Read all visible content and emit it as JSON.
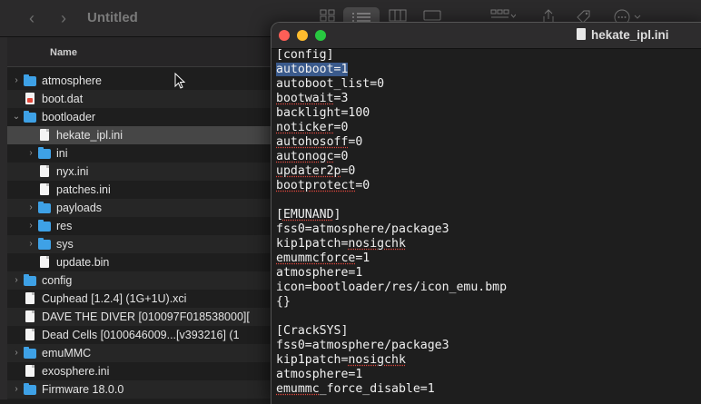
{
  "finder": {
    "title": "Untitled",
    "column_name": "Name",
    "rows": [
      {
        "label": "atmosphere",
        "type": "folder",
        "indent": 0,
        "disclosure": "›"
      },
      {
        "label": "boot.dat",
        "type": "dat",
        "indent": 0,
        "disclosure": ""
      },
      {
        "label": "bootloader",
        "type": "folder",
        "indent": 0,
        "disclosure": "⌄"
      },
      {
        "label": "hekate_ipl.ini",
        "type": "doc",
        "indent": 1,
        "disclosure": "",
        "selected": true
      },
      {
        "label": "ini",
        "type": "folder",
        "indent": 1,
        "disclosure": "›"
      },
      {
        "label": "nyx.ini",
        "type": "doc",
        "indent": 1,
        "disclosure": ""
      },
      {
        "label": "patches.ini",
        "type": "doc",
        "indent": 1,
        "disclosure": ""
      },
      {
        "label": "payloads",
        "type": "folder",
        "indent": 1,
        "disclosure": "›"
      },
      {
        "label": "res",
        "type": "folder",
        "indent": 1,
        "disclosure": "›"
      },
      {
        "label": "sys",
        "type": "folder",
        "indent": 1,
        "disclosure": "›"
      },
      {
        "label": "update.bin",
        "type": "doc",
        "indent": 1,
        "disclosure": ""
      },
      {
        "label": "config",
        "type": "folder",
        "indent": 0,
        "disclosure": "›"
      },
      {
        "label": "Cuphead [1.2.4] (1G+1U).xci",
        "type": "doc",
        "indent": 0,
        "disclosure": ""
      },
      {
        "label": "DAVE THE DIVER [010097F018538000][",
        "type": "doc",
        "indent": 0,
        "disclosure": ""
      },
      {
        "label": "Dead Cells [0100646009...[v393216] (1",
        "type": "doc",
        "indent": 0,
        "disclosure": ""
      },
      {
        "label": "emuMMC",
        "type": "folder",
        "indent": 0,
        "disclosure": "›"
      },
      {
        "label": "exosphere.ini",
        "type": "doc",
        "indent": 0,
        "disclosure": ""
      },
      {
        "label": "Firmware 18.0.0",
        "type": "folder",
        "indent": 0,
        "disclosure": "›"
      }
    ]
  },
  "editor": {
    "title": "hekate_ipl.ini",
    "lines": [
      {
        "text": "[config]"
      },
      {
        "text": "autoboot=1",
        "selected": true
      },
      {
        "text": "autoboot_list=0"
      },
      {
        "text": "bootwait=3",
        "spell": "bootwait"
      },
      {
        "text": "backlight=100"
      },
      {
        "text": "noticker=0",
        "spell": "noticker"
      },
      {
        "text": "autohosoff=0",
        "spell": "autohosoff"
      },
      {
        "text": "autonogc=0",
        "spell": "autonogc"
      },
      {
        "text": "updater2p=0",
        "spell": "updater2p"
      },
      {
        "text": "bootprotect=0",
        "spell": "bootprotect"
      },
      {
        "text": ""
      },
      {
        "text": "[EMUNAND]",
        "spell": "EMUNAND"
      },
      {
        "text": "fss0=atmosphere/package3"
      },
      {
        "text": "kip1patch=nosigchk",
        "spell": "nosigchk"
      },
      {
        "text": "emummcforce=1",
        "spell": "emummcforce"
      },
      {
        "text": "atmosphere=1"
      },
      {
        "text": "icon=bootloader/res/icon_emu.bmp"
      },
      {
        "text": "{}"
      },
      {
        "text": ""
      },
      {
        "text": "[CrackSYS]"
      },
      {
        "text": "fss0=atmosphere/package3"
      },
      {
        "text": "kip1patch=nosigchk",
        "spell": "nosigchk"
      },
      {
        "text": "atmosphere=1"
      },
      {
        "text": "emummc_force_disable=1",
        "spell": "emummc"
      }
    ]
  }
}
